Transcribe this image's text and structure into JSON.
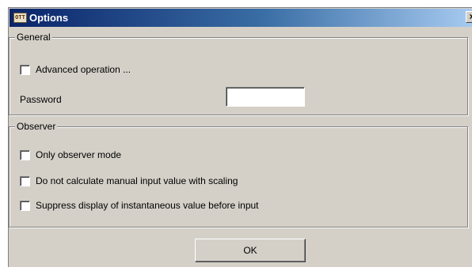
{
  "window": {
    "title": "Options",
    "icon_text": "OTT",
    "close_glyph": "×",
    "icon": "app-icon"
  },
  "general": {
    "legend": "General",
    "advanced_operation": {
      "label": "Advanced operation ...",
      "checked": false
    },
    "password": {
      "label": "Password",
      "value": ""
    }
  },
  "observer": {
    "legend": "Observer",
    "options": [
      {
        "label": "Only observer mode",
        "checked": false
      },
      {
        "label": "Do not calculate manual input value with scaling",
        "checked": false
      },
      {
        "label": "Suppress display of instantaneous value before input",
        "checked": false
      }
    ]
  },
  "buttons": {
    "ok_label": "OK"
  },
  "colors": {
    "face": "#d4d0c8",
    "titlebar_start": "#0a246a",
    "titlebar_end": "#a6caf0"
  }
}
